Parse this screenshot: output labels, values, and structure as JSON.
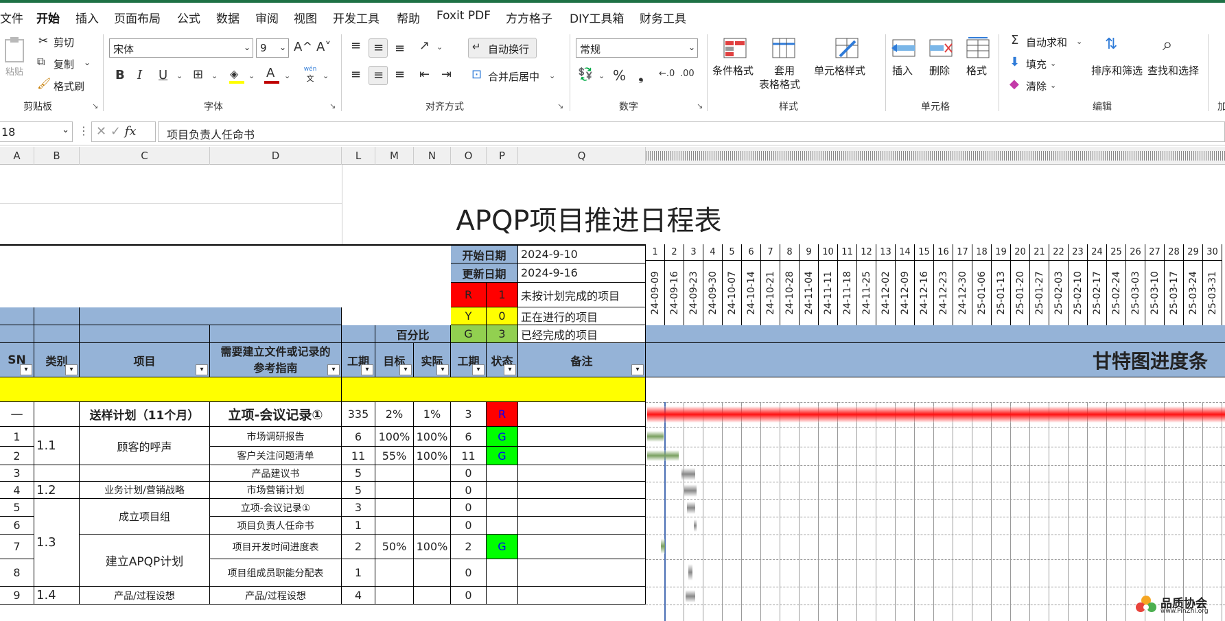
{
  "tabs": [
    "文件",
    "开始",
    "插入",
    "页面布局",
    "公式",
    "数据",
    "审阅",
    "视图",
    "开发工具",
    "帮助",
    "Foxit PDF",
    "方方格子",
    "DIY工具箱",
    "财务工具"
  ],
  "ribbon": {
    "clipboard": {
      "paste": "粘贴",
      "cut": "剪切",
      "copy": "复制",
      "format_painter": "格式刷",
      "group": "剪贴板"
    },
    "font": {
      "name": "宋体",
      "size": "9",
      "grow": "A^",
      "shrink": "A˅",
      "bold": "B",
      "italic": "I",
      "underline": "U",
      "phonetic": "wén",
      "phonetic_sub": "文",
      "group": "字体"
    },
    "alignment": {
      "wrap": "自动换行",
      "merge": "合并后居中",
      "group": "对齐方式"
    },
    "number": {
      "format": "常规",
      "group": "数字"
    },
    "styles": {
      "cond": "条件格式",
      "table_line1": "套用",
      "table_line2": "表格格式",
      "cell": "单元格样式",
      "group": "样式"
    },
    "cells": {
      "insert": "插入",
      "delete": "删除",
      "format": "格式",
      "group": "单元格"
    },
    "editing": {
      "autosum": "自动求和",
      "fill": "填充",
      "clear": "清除",
      "sort": "排序和筛选",
      "find": "查找和选择",
      "group": "编辑"
    },
    "more": "加"
  },
  "formula_bar": {
    "name_box": "18",
    "formula": "项目负责人任命书"
  },
  "columns": [
    "A",
    "B",
    "C",
    "D",
    "L",
    "M",
    "N",
    "O",
    "P",
    "Q"
  ],
  "sheet": {
    "title": "APQP项目推进日程表",
    "start_label": "开始日期",
    "start_value": "2024-9-10",
    "update_label": "更新日期",
    "update_value": "2024-9-16",
    "legend": [
      {
        "code": "R",
        "count": "1",
        "desc": "未按计划完成的项目",
        "color": "#ff0000"
      },
      {
        "code": "Y",
        "count": "0",
        "desc": "正在进行的项目",
        "color": "#ffff00"
      },
      {
        "code": "G",
        "count": "3",
        "desc": "已经完成的项目",
        "color": "#92d050"
      }
    ],
    "percent_label": "百分比",
    "headers": {
      "sn": "SN",
      "category": "类别",
      "item": "项目",
      "guide_line1": "需要建立文件或记录的",
      "guide_line2": "参考指南",
      "period": "工期",
      "target": "目标",
      "actual": "实际",
      "period2": "工期",
      "status": "状态",
      "remark": "备注",
      "gantt": "甘特图进度条"
    },
    "weeks": [
      "1",
      "2",
      "3",
      "4",
      "5",
      "6",
      "7",
      "8",
      "9",
      "10",
      "11",
      "12",
      "13",
      "14",
      "15",
      "16",
      "17",
      "18",
      "19",
      "20",
      "21",
      "22",
      "23",
      "24",
      "25",
      "26",
      "27",
      "28",
      "29",
      "30"
    ],
    "dates": [
      "24-09-09",
      "24-09-16",
      "24-09-23",
      "24-09-30",
      "24-10-07",
      "24-10-14",
      "24-10-21",
      "24-10-28",
      "24-11-04",
      "24-11-11",
      "24-11-18",
      "24-11-25",
      "24-12-02",
      "24-12-09",
      "24-12-16",
      "24-12-23",
      "24-12-30",
      "25-01-06",
      "25-01-13",
      "25-01-20",
      "25-01-27",
      "25-02-03",
      "25-02-10",
      "25-02-17",
      "25-02-24",
      "25-03-03",
      "25-03-10",
      "25-03-17",
      "25-03-24",
      "25-03-31"
    ],
    "summary": {
      "sn": "一",
      "category": "送样计划（11个月）",
      "guide": "立项-会议记录①",
      "period": "335",
      "target": "2%",
      "actual": "1%",
      "period2": "3",
      "status": "R"
    },
    "groups": [
      {
        "code": "1.1",
        "name": "顾客的呼声"
      },
      {
        "code": "1.2",
        "name": "业务计划/营销战略"
      },
      {
        "code": "1.3",
        "name_top": "成立项目组",
        "name_bottom": "建立APQP计划"
      },
      {
        "code": "1.4",
        "name": "产品/过程设想"
      }
    ],
    "rows": [
      {
        "sn": "1",
        "guide": "市场调研报告",
        "period": "6",
        "target": "100%",
        "actual": "100%",
        "period2": "6",
        "status": "G"
      },
      {
        "sn": "2",
        "guide": "客户关注问题清单",
        "period": "11",
        "target": "55%",
        "actual": "100%",
        "period2": "11",
        "status": "G"
      },
      {
        "sn": "3",
        "guide": "产品建议书",
        "period": "5",
        "target": "",
        "actual": "",
        "period2": "0",
        "status": ""
      },
      {
        "sn": "4",
        "guide": "市场营销计划",
        "period": "5",
        "target": "",
        "actual": "",
        "period2": "0",
        "status": ""
      },
      {
        "sn": "5",
        "guide": "立项-会议记录①",
        "period": "3",
        "target": "",
        "actual": "",
        "period2": "0",
        "status": ""
      },
      {
        "sn": "6",
        "guide": "项目负责人任命书",
        "period": "1",
        "target": "",
        "actual": "",
        "period2": "0",
        "status": ""
      },
      {
        "sn": "7",
        "guide": "项目开发时间进度表",
        "period": "2",
        "target": "50%",
        "actual": "100%",
        "period2": "2",
        "status": "G"
      },
      {
        "sn": "8",
        "guide": "项目组成员职能分配表",
        "period": "1",
        "target": "",
        "actual": "",
        "period2": "0",
        "status": ""
      },
      {
        "sn": "9",
        "guide": "产品/过程设想",
        "period": "4",
        "target": "",
        "actual": "",
        "period2": "0",
        "status": ""
      }
    ],
    "colors": {
      "header_blue": "#95b3d7",
      "red": "#ff0000",
      "green": "#00ff00",
      "yellow": "#ffff00",
      "accent": "#1e7145"
    }
  },
  "watermark": {
    "line1": "品质协会",
    "line2": "www.PinZhi.org"
  }
}
